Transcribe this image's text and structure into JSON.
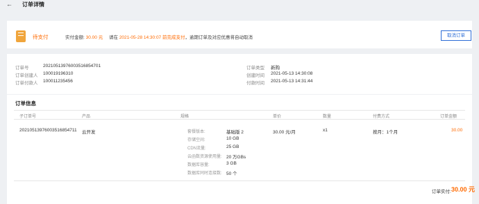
{
  "header": {
    "back_icon": "arrow-left-icon",
    "title": "订单详情"
  },
  "status": {
    "label": "待支付",
    "amount_label": "实付金额:",
    "amount_value": "30.00 元",
    "deadline_prefix": "请在",
    "deadline_time": "2021-05-28 14:30:07 前完成支付",
    "deadline_suffix": "，逾期订单及对应优惠将自动取消",
    "cancel_label": "取消订单",
    "accent": "#ff6a00",
    "icon_color": "#f0a53c"
  },
  "info": {
    "left": [
      {
        "label": "订单号",
        "value": "20210513976003516854701"
      },
      {
        "label": "订单创建人",
        "value": "100019196310"
      },
      {
        "label": "订单付款人",
        "value": "100011235456"
      }
    ],
    "right": [
      {
        "label": "订单类型",
        "value": "新购"
      },
      {
        "label": "创建时间",
        "value": "2021-05-13 14:30:08"
      },
      {
        "label": "付款时间",
        "value": "2021-05-13 14:31:44"
      }
    ]
  },
  "table": {
    "title": "订单信息",
    "columns": [
      "子订单号",
      "产品",
      "规格",
      "单价",
      "数量",
      "付费方式",
      "订单金额"
    ],
    "row": {
      "sub_order": "20210513976003516854711",
      "product": "云开发",
      "specs": [
        {
          "k": "套餐版本:",
          "v": "基础版 2"
        },
        {
          "k": "存储空间:",
          "v": "10 GB"
        },
        {
          "k": "CDN流量:",
          "v": "25 GB"
        },
        {
          "k": "云函数资源使用量:",
          "v": "20 万GBs"
        },
        {
          "k": "数据库容量:",
          "v": "3 GB"
        },
        {
          "k": "数据库同时连接数:",
          "v": "50 个"
        }
      ],
      "unit_price": "30.00 元/月",
      "quantity": "x1",
      "pay_method": "按月：1个月",
      "amount": "30.00"
    }
  },
  "total": {
    "label": "订单实付:",
    "value": "30.00 元"
  }
}
